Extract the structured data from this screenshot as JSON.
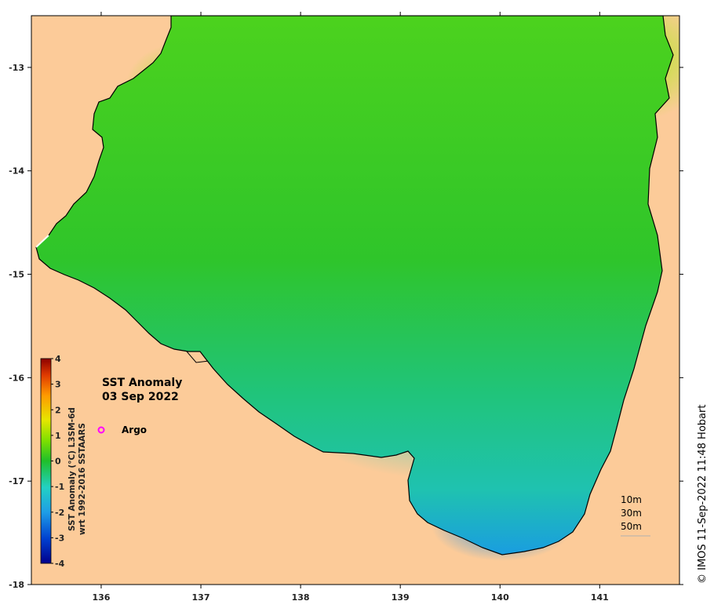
{
  "map": {
    "title": "SST Anomaly",
    "date": "03 Sep 2022",
    "credit": "© IMOS 11-Sep-2022 11:48 Hobart",
    "extent": {
      "lon": [
        135.3,
        141.8
      ],
      "lat": [
        -18.0,
        -12.5
      ]
    },
    "lon_ticks": [
      "136",
      "137",
      "138",
      "139",
      "140",
      "141"
    ],
    "lat_ticks": [
      "-13",
      "-14",
      "-15",
      "-16",
      "-17",
      "-18"
    ],
    "colors": {
      "land": "#fccb99",
      "coast": "#000000",
      "contour": "#b0b0b0"
    }
  },
  "legend": {
    "marker_label": "Argo",
    "marker_color": "#ff00ff",
    "depth_labels": [
      "10m",
      "30m",
      "50m"
    ]
  },
  "colorbar": {
    "label_line1": "SST Anomaly (°C) L3SM-6d",
    "label_line2": "wrt 1992-2016 SSTAARS",
    "ticks": [
      "4",
      "3",
      "2",
      "1",
      "0",
      "-1",
      "-2",
      "-3",
      "-4"
    ],
    "range": [
      -4,
      4
    ]
  }
}
